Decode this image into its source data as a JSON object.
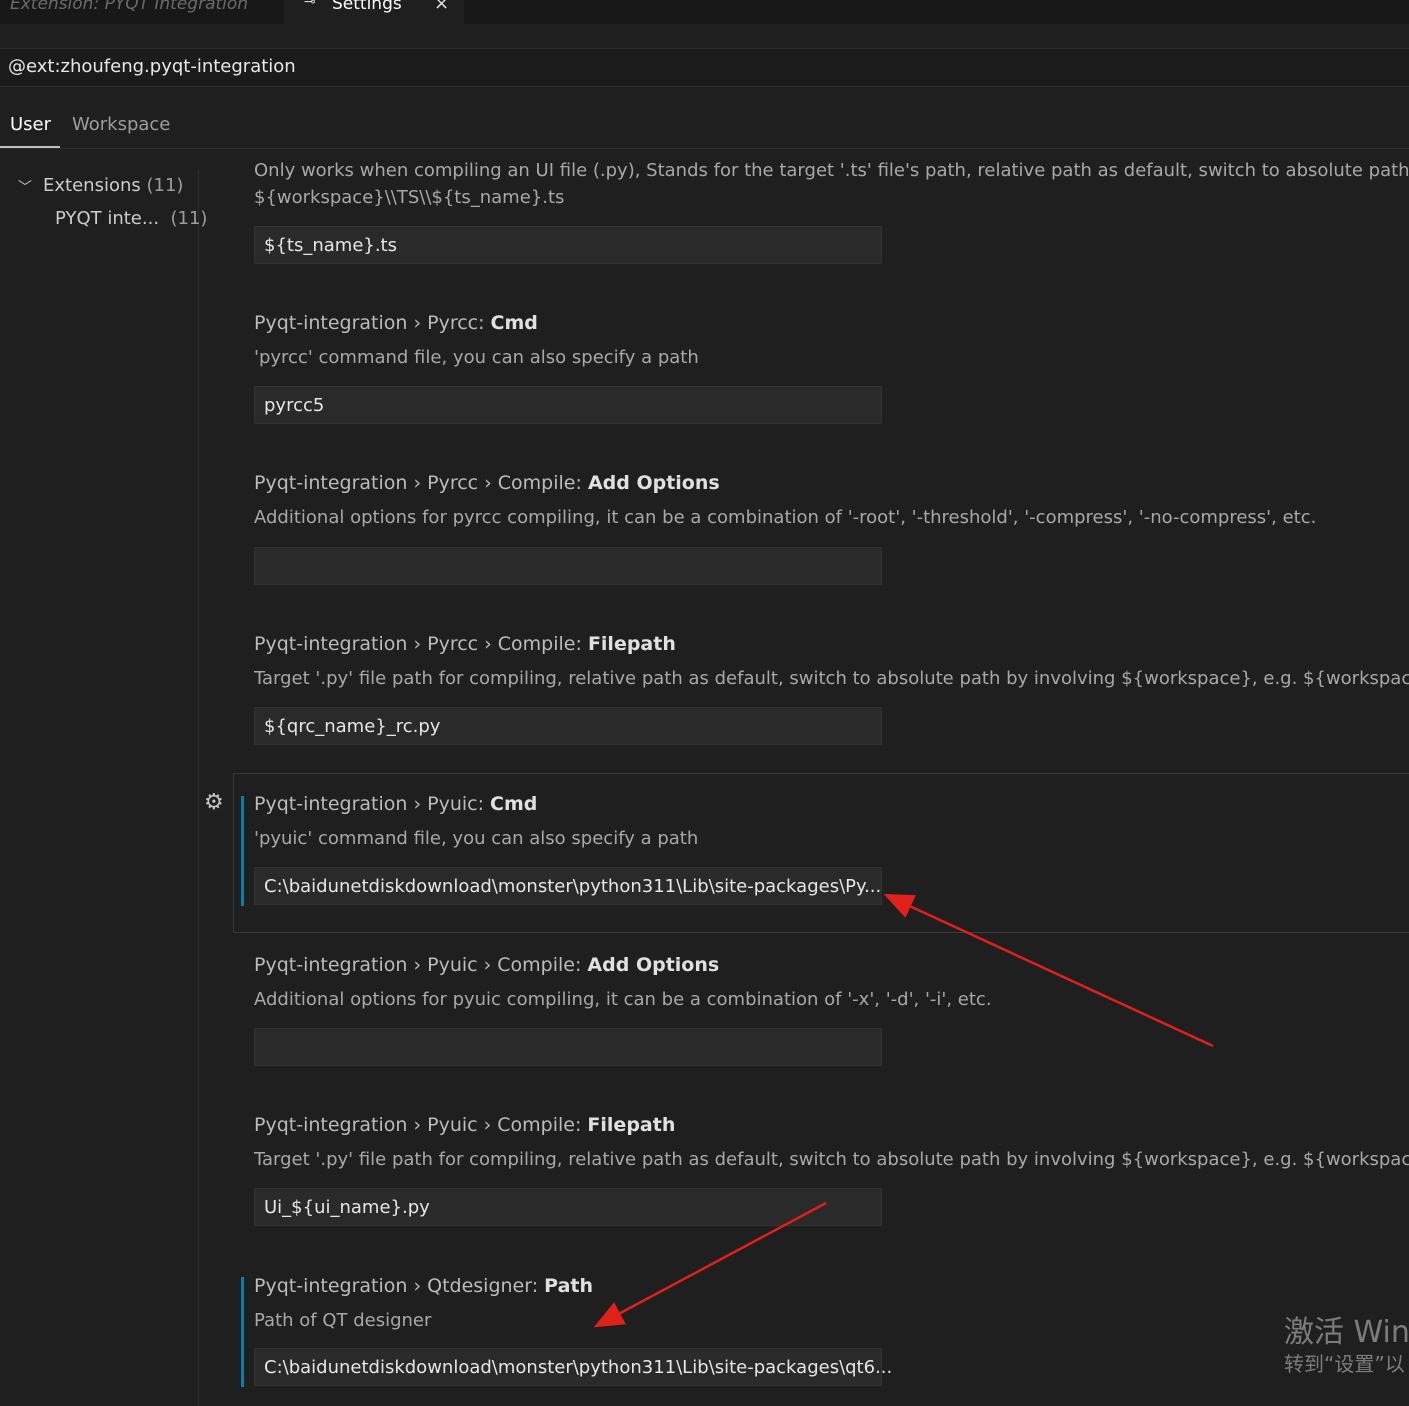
{
  "tabs": [
    {
      "label": "Extension: PYQT Integration",
      "active": false
    },
    {
      "label": "Settings",
      "active": true,
      "icon": "settings-pin-icon",
      "close": "×"
    }
  ],
  "search": {
    "value": "@ext:zhoufeng.pyqt-integration"
  },
  "scopes": {
    "user": "User",
    "workspace": "Workspace"
  },
  "toc": {
    "extensions": {
      "label": "Extensions",
      "count": "(11)"
    },
    "pyqt": {
      "label": "PYQT inte...",
      "count": "(11)"
    }
  },
  "settings": {
    "ts_path": {
      "desc_line1": "Only works when compiling an UI file (.py), Stands for the target '.ts' file's path, relative path as default, switch to absolute path by invo",
      "desc_line2": "${workspace}\\\\TS\\\\${ts_name}.ts",
      "value": "${ts_name}.ts"
    },
    "pyrcc_cmd": {
      "category": "Pyqt-integration › Pyrcc: ",
      "name": "Cmd",
      "desc": "'pyrcc' command file, you can also specify a path",
      "value": "pyrcc5"
    },
    "pyrcc_add_options": {
      "category": "Pyqt-integration › Pyrcc › Compile: ",
      "name": "Add Options",
      "desc": "Additional options for pyrcc compiling, it can be a combination of '-root', '-threshold', '-compress', '-no-compress', etc.",
      "value": ""
    },
    "pyrcc_filepath": {
      "category": "Pyqt-integration › Pyrcc › Compile: ",
      "name": "Filepath",
      "desc": "Target '.py' file path for compiling, relative path as default, switch to absolute path by involving ${workspace}, e.g. ${workspace}\\\\QRC\\\\",
      "value": "${qrc_name}_rc.py"
    },
    "pyuic_cmd": {
      "category": "Pyqt-integration › Pyuic: ",
      "name": "Cmd",
      "desc": "'pyuic' command file, you can also specify a path",
      "value": "C:\\baidunetdiskdownload\\monster\\python311\\Lib\\site-packages\\Py..."
    },
    "pyuic_add_options": {
      "category": "Pyqt-integration › Pyuic › Compile: ",
      "name": "Add Options",
      "desc": "Additional options for pyuic compiling, it can be a combination of '-x', '-d', '-i', etc.",
      "value": ""
    },
    "pyuic_filepath": {
      "category": "Pyqt-integration › Pyuic › Compile: ",
      "name": "Filepath",
      "desc": "Target '.py' file path for compiling, relative path as default, switch to absolute path by involving ${workspace}, e.g. ${workspace}\\\\UI\\\\Ui",
      "value": "Ui_${ui_name}.py"
    },
    "qtdesigner_path": {
      "category": "Pyqt-integration › Qtdesigner: ",
      "name": "Path",
      "desc": "Path of QT designer",
      "value": "C:\\baidunetdiskdownload\\monster\\python311\\Lib\\site-packages\\qt6..."
    }
  },
  "watermark": {
    "line1": "激活 Win",
    "line2": "转到“设置”以"
  },
  "colors": {
    "background": "#1f1f1f",
    "modified_indicator": "#0e7dac",
    "annotation_arrow": "#e0201b"
  }
}
